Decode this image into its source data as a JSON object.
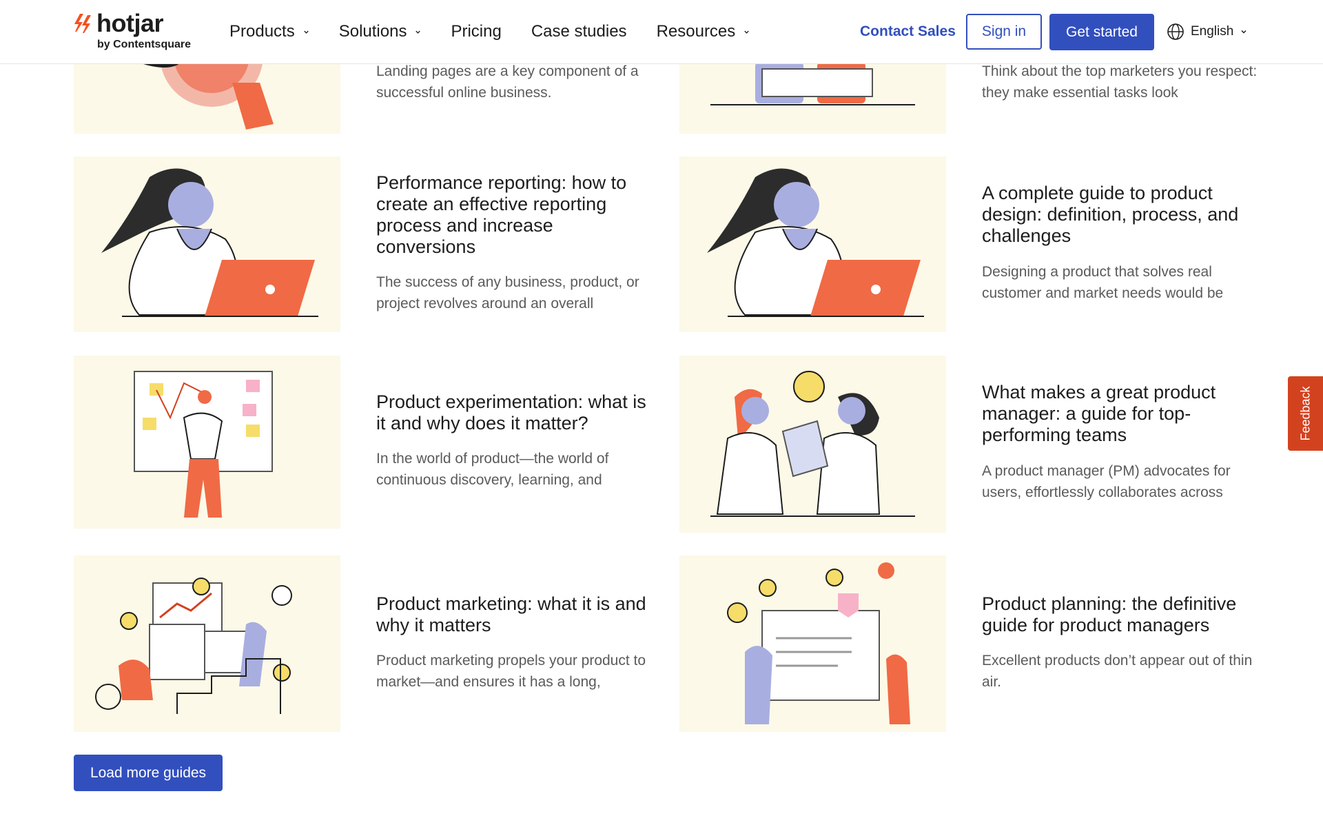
{
  "header": {
    "brand": "hotjar",
    "brand_sub": "by Contentsquare",
    "nav": [
      {
        "label": "Products",
        "dropdown": true
      },
      {
        "label": "Solutions",
        "dropdown": true
      },
      {
        "label": "Pricing",
        "dropdown": false
      },
      {
        "label": "Case studies",
        "dropdown": false
      },
      {
        "label": "Resources",
        "dropdown": true
      }
    ],
    "contact_sales": "Contact Sales",
    "sign_in": "Sign in",
    "get_started": "Get started",
    "language": "English"
  },
  "guides": {
    "partial_row": [
      {
        "title": "",
        "desc": "Landing pages are a key component of a successful online business."
      },
      {
        "title": "",
        "desc": "Think about the top marketers you respect: they make essential tasks look"
      }
    ],
    "rows": [
      [
        {
          "title": "Performance reporting: how to create an effective reporting process and increase conversions",
          "desc": "The success of any business, product, or project revolves around an overall"
        },
        {
          "title": "A complete guide to product design: definition, process, and challenges",
          "desc": "Designing a product that solves real customer and market needs would be"
        }
      ],
      [
        {
          "title": "Product experimentation: what is it and why does it matter?",
          "desc": "In the world of product—the world of continuous discovery, learning, and"
        },
        {
          "title": "What makes a great product manager: a guide for top-performing teams",
          "desc": "A product manager (PM) advocates for users, effortlessly collaborates across"
        }
      ],
      [
        {
          "title": "Product marketing: what it is and why it matters",
          "desc": "Product marketing propels your product to market—and ensures it has a long,"
        },
        {
          "title": "Product planning: the definitive guide for product managers",
          "desc": "Excellent products don’t appear out of thin air."
        }
      ]
    ],
    "load_more": "Load more guides"
  },
  "feedback_tab": "Feedback",
  "colors": {
    "accent": "#324fbe",
    "brand_orange": "#f4511e",
    "card_bg": "#fcf9e8",
    "feedback": "#d3421f"
  }
}
